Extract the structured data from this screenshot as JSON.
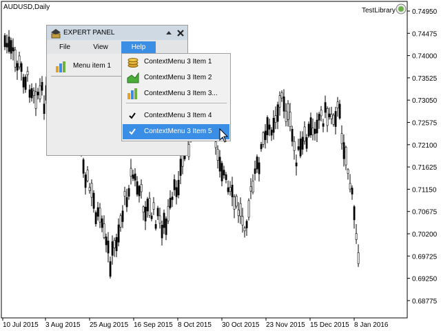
{
  "chart": {
    "symbol": "AUDUSD,Daily",
    "library_label": "TestLibrary",
    "price_ticks": [
      "0.74950",
      "0.74475",
      "0.74000",
      "0.73525",
      "0.73050",
      "0.72575",
      "0.72100",
      "0.71625",
      "0.71150",
      "0.70675",
      "0.70200",
      "0.69725",
      "0.69250",
      "0.68775"
    ],
    "date_ticks": [
      "10 Jul 2015",
      "3 Aug 2015",
      "25 Aug 2015",
      "16 Sep 2015",
      "8 Oct 2015",
      "30 Oct 2015",
      "23 Nov 2015",
      "15 Dec 2015",
      "8 Jan 2016"
    ]
  },
  "panel": {
    "title": "EXPERT PANEL",
    "menus": [
      {
        "label": "File"
      },
      {
        "label": "View"
      },
      {
        "label": "Help"
      }
    ],
    "item_label": "Menu item 1"
  },
  "context_menu": {
    "items": [
      {
        "label": "ContextMenu 3 Item 1",
        "icon": "coins-icon"
      },
      {
        "label": "ContextMenu 3 Item 2",
        "icon": "area-chart-icon"
      },
      {
        "label": "ContextMenu 3 Item 3...",
        "icon": "bar-chart-icon"
      },
      {
        "label": "ContextMenu 3 Item 4",
        "icon": "checkmark-icon"
      },
      {
        "label": "ContextMenu 3 Item 5",
        "icon": "checkmark-icon"
      }
    ]
  }
}
